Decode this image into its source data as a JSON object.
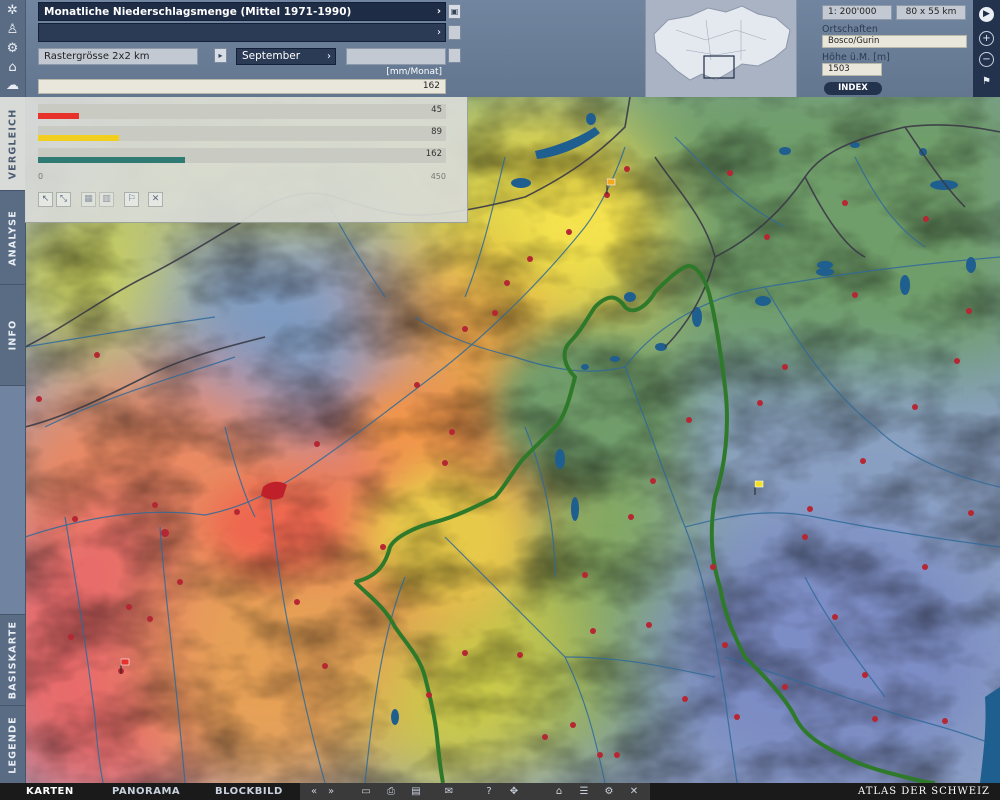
{
  "header": {
    "map_title": "Monatliche Niederschlagsmenge (Mittel 1971-1990)",
    "subtitle": "",
    "raster_label": "Rastergrösse 2x2 km",
    "month": "September",
    "unit": "[mm/Monat]",
    "point_value": "162"
  },
  "overview": {
    "scale": "1: 200'000",
    "extent": "80 x 55 km",
    "place_label": "Ortschaften",
    "place_value": "Bosco/Gurin",
    "elev_label": "Höhe ü.M. [m]",
    "elev_value": "1503",
    "index_label": "INDEX"
  },
  "comparison": {
    "axis_min": "0",
    "axis_max": "450",
    "bars": [
      {
        "value": 45,
        "label": "45",
        "color": "#e8312b"
      },
      {
        "value": 89,
        "label": "89",
        "color": "#f2cf1f"
      },
      {
        "value": 162,
        "label": "162",
        "color": "#2f7a73"
      }
    ]
  },
  "side_tabs": {
    "vergleich": "VERGLEICH",
    "analyse": "ANALYSE",
    "info": "INFO",
    "basiskarte": "BASISKARTE",
    "legende": "LEGENDE"
  },
  "bottom": {
    "karten": "KARTEN",
    "panorama": "PANORAMA",
    "blockbild": "BLOCKBILD",
    "brand": "ATLAS DER SCHWEIZ"
  },
  "icons": {
    "tools": [
      "wheel-icon",
      "hiker-icon",
      "gear-icon",
      "building-icon",
      "cloud-icon"
    ],
    "nav": [
      "play-icon",
      "zoom-in-icon",
      "zoom-out-icon",
      "flag-icon"
    ]
  }
}
